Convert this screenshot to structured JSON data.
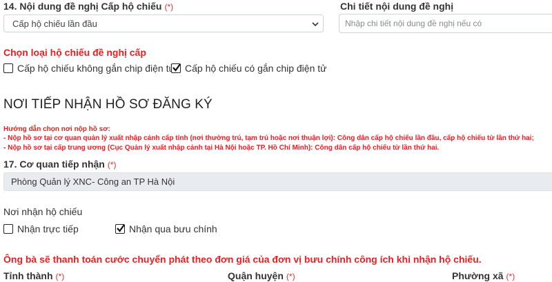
{
  "field14": {
    "label": "14. Nội dung đề nghị Cấp hộ chiếu",
    "required": "(*)",
    "selected": "Cấp hộ chiếu lần đầu"
  },
  "detail": {
    "label": "Chi tiết nội dung đề nghị",
    "placeholder": "Nhập chi tiết nội dung đề nghị nếu có"
  },
  "passport_type": {
    "title": "Chọn loại hộ chiếu đề nghị cấp",
    "options": [
      {
        "label": "Cấp hộ chiếu không gắn chip điện tử",
        "checked": false
      },
      {
        "label": "Cấp hộ chiếu có gắn chip điện tử",
        "checked": true
      }
    ]
  },
  "section": {
    "title": "NƠI TIẾP NHẬN HỒ SƠ ĐĂNG KÝ"
  },
  "guidance": {
    "lines": [
      "Hướng dẫn chọn nơi nộp hồ sơ:",
      "- Nộp hồ sơ tại cơ quan quản lý xuất nhập cảnh cấp tỉnh (nơi thường trú, tạm trú hoặc nơi thuận lợi): Công dân cấp hộ chiếu lần đầu, cấp hộ chiếu từ lần thứ hai;",
      "- Nộp hồ sơ tại cấp trung ương (Cục Quản lý xuất nhập cảnh tại Hà Nội hoặc TP. Hồ Chí Minh): Công dân cấp hộ chiếu từ lần thứ hai."
    ]
  },
  "field17": {
    "label": "17. Cơ quan tiếp nhận",
    "required": "(*)",
    "value": "Phòng Quản lý XNC- Công an TP Hà Nội"
  },
  "receive": {
    "label": "Nơi nhận hộ chiếu",
    "options": [
      {
        "label": "Nhận trực tiếp",
        "checked": false
      },
      {
        "label": "Nhận qua bưu chính",
        "checked": true
      }
    ]
  },
  "postal_note": "Ông bà sẽ thanh toán cước chuyển phát theo đơn giá của đơn vị bưu chính công ích khi nhận hộ chiếu.",
  "address": {
    "province": {
      "label": "Tỉnh thành",
      "required": "(*)"
    },
    "district": {
      "label": "Quận huyện",
      "required": "(*)"
    },
    "ward": {
      "label": "Phường xã",
      "required": "(*)"
    }
  },
  "colors": {
    "required": "#e03030",
    "alert_red": "#e8201e",
    "readonly_bg": "#e9ecef",
    "border": "#ced4da"
  }
}
